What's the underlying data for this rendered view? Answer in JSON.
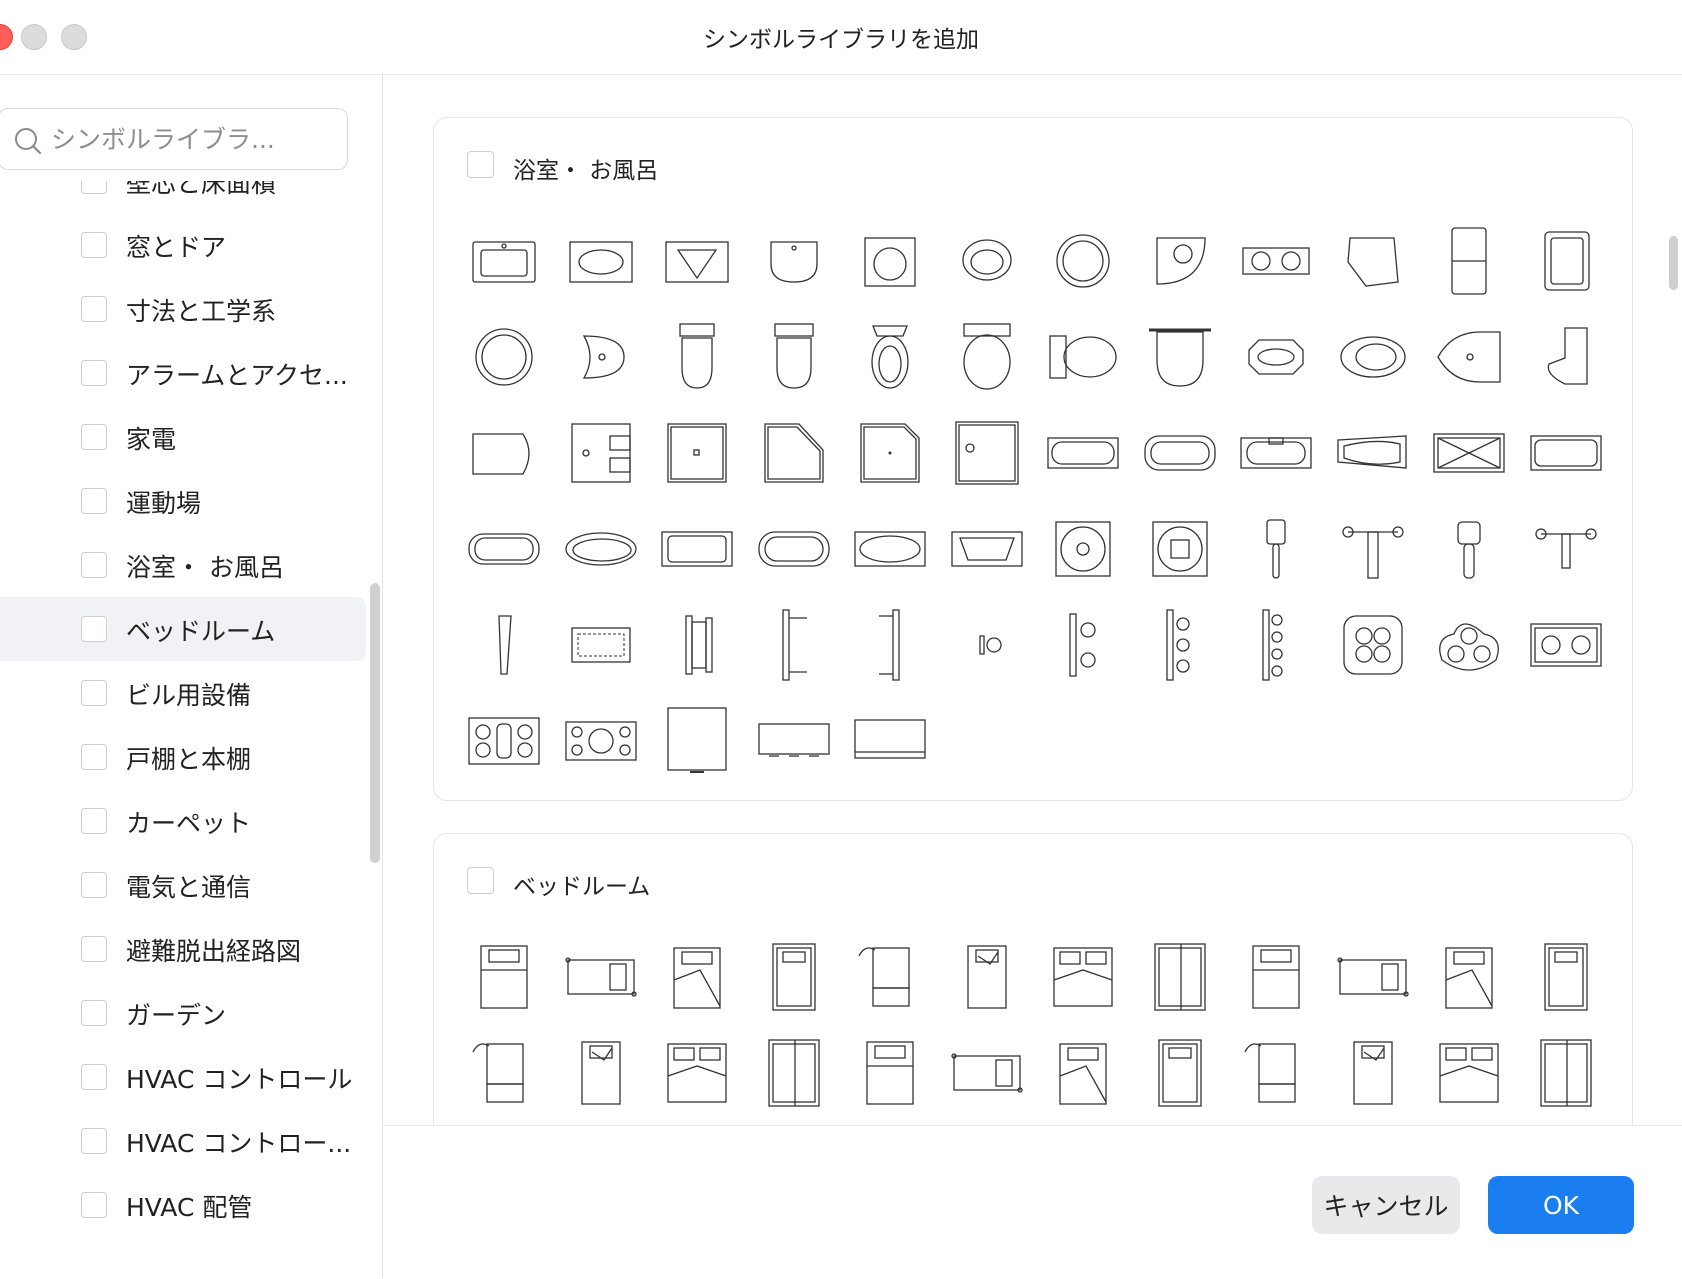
{
  "window": {
    "title": "シンボルライブラリを追加"
  },
  "search": {
    "placeholder": "シンボルライブラ..."
  },
  "categories": [
    {
      "label": "壁芯と床面積"
    },
    {
      "label": "窓とドア"
    },
    {
      "label": "寸法と工学系"
    },
    {
      "label": "アラームとアクセ..."
    },
    {
      "label": "家電"
    },
    {
      "label": "運動場"
    },
    {
      "label": "浴室・ お風呂"
    },
    {
      "label": "ベッドルーム"
    },
    {
      "label": "ビル用設備"
    },
    {
      "label": "戸棚と本棚"
    },
    {
      "label": "カーペット"
    },
    {
      "label": "電気と通信"
    },
    {
      "label": "避難脱出経路図"
    },
    {
      "label": "ガーデン"
    },
    {
      "label": "HVAC コントロール"
    },
    {
      "label": "HVAC コントロー..."
    },
    {
      "label": "HVAC 配管"
    }
  ],
  "selected_category": "ベッドルーム",
  "sections": [
    {
      "title": "浴室・ お風呂",
      "symbols": [
        "sink-rect",
        "sink-oval-counter",
        "sink-triangle",
        "sink-wall",
        "sink-square-round",
        "sink-round-small",
        "sink-round",
        "sink-corner",
        "sink-double",
        "sink-pentagon",
        "sink-double-vertical",
        "sink-single-vertical",
        "sink-circle-large",
        "sink-half-round",
        "toilet-tank",
        "toilet-tank-b",
        "toilet-oval",
        "toilet-large",
        "toilet-side",
        "bidet",
        "tub-oval-octagon",
        "tub-oval",
        "tub-boat",
        "urinal",
        "urinal-side",
        "shower-rect",
        "shower-square",
        "shower-pentagon",
        "shower-corner",
        "shower-square-b",
        "bathtub-rect",
        "bathtub-rounded",
        "bathtub-round-end",
        "bathtub-curved",
        "bathtub-grid",
        "bathtub-rect-b",
        "bathtub-oval-a",
        "bathtub-oval-b",
        "bathtub-rect-c",
        "bathtub-oval-c",
        "bathtub-oval-d",
        "bathtub-corner",
        "drain-flower",
        "drain-grid",
        "faucet-single",
        "faucet-t",
        "faucet-handle",
        "faucet-cross",
        "shower-head",
        "mat",
        "towel-bar-short",
        "towel-bar-mid",
        "towel-bar-long",
        "hook-single",
        "hook-double",
        "hook-triple",
        "hook-quad",
        "jacuzzi-quad",
        "jacuzzi-triple",
        "jacuzzi-double",
        "jacuzzi-rect",
        "jacuzzi-oval",
        "cabinet-square",
        "vanity-wide",
        "vanity-wide-b"
      ]
    },
    {
      "title": "ベッドルーム",
      "symbols": [
        "bed-single",
        "bed-desk",
        "bed-single-b",
        "bed-single-c",
        "bed-lamp",
        "bed-single-d",
        "bed-double",
        "bed-double-b",
        "wardrobe",
        "bed-double-c",
        "bed-double-d",
        "bed-bunk",
        "bed-double-e",
        "bed-double-f",
        "bed-double-g",
        "bed-side",
        "bed-side-b",
        "bed-side-c",
        "bed-side-d",
        "bed-round",
        "bed-capsule",
        "bed-tv",
        "bed-tv-b",
        "bed-round-b"
      ]
    }
  ],
  "buttons": {
    "cancel": "キャンセル",
    "ok": "OK"
  }
}
